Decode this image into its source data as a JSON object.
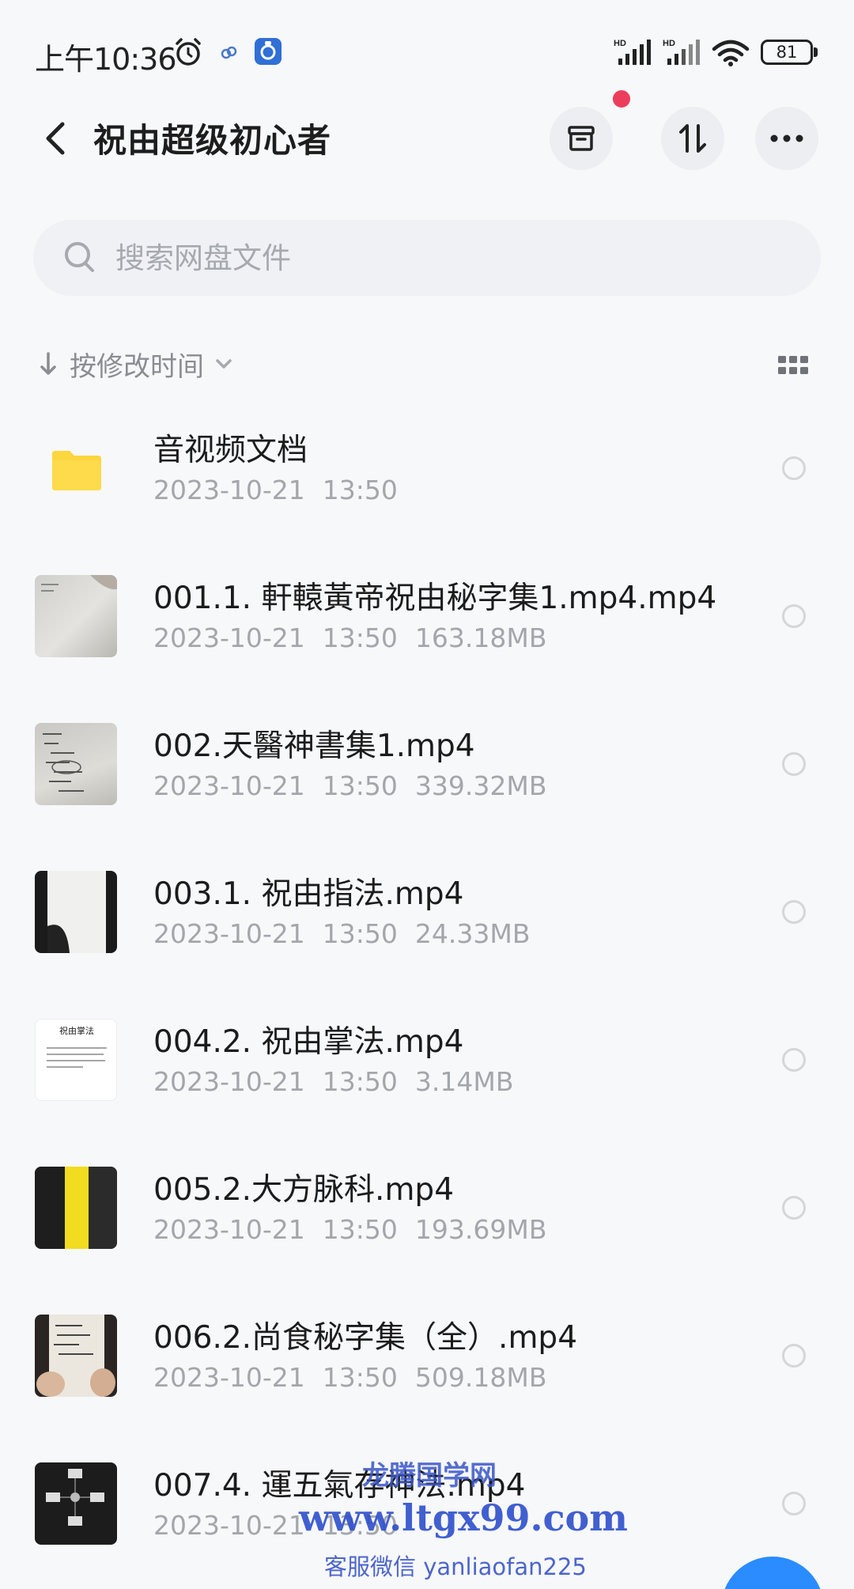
{
  "status_bar": {
    "time": "上午10:36",
    "signal1_label": "HD",
    "signal2_label": "HD",
    "battery": "81"
  },
  "header": {
    "title": "祝由超级初心者"
  },
  "search": {
    "placeholder": "搜索网盘文件"
  },
  "sort": {
    "label": "按修改时间"
  },
  "files": [
    {
      "name": "音视频文档",
      "date": "2023-10-21",
      "time": "13:50",
      "size": ""
    },
    {
      "name": "001.1. 軒轅黃帝祝由秘字集1.mp4.mp4",
      "date": "2023-10-21",
      "time": "13:50",
      "size": "163.18MB"
    },
    {
      "name": "002.天醫神書集1.mp4",
      "date": "2023-10-21",
      "time": "13:50",
      "size": "339.32MB"
    },
    {
      "name": "003.1. 祝由指法.mp4",
      "date": "2023-10-21",
      "time": "13:50",
      "size": "24.33MB"
    },
    {
      "name": "004.2. 祝由掌法.mp4",
      "date": "2023-10-21",
      "time": "13:50",
      "size": "3.14MB"
    },
    {
      "name": "005.2.大方脉科.mp4",
      "date": "2023-10-21",
      "time": "13:50",
      "size": "193.69MB"
    },
    {
      "name": "006.2.尚食秘字集（全）.mp4",
      "date": "2023-10-21",
      "time": "13:50",
      "size": "509.18MB"
    },
    {
      "name": "007.4. 運五氣存神法.mp4",
      "date": "2023-10-21",
      "time": "13:50",
      "size": ""
    }
  ],
  "thumbnail_doc_title": "祝由掌法",
  "watermark": {
    "line1": "龙腾国学网",
    "line2": "www.ltgx99.com",
    "line3": "客服微信 yanliaofan225"
  },
  "colors": {
    "accent": "#2a8cff",
    "notification": "#ec3e5c",
    "folder": "#fcd63f"
  }
}
